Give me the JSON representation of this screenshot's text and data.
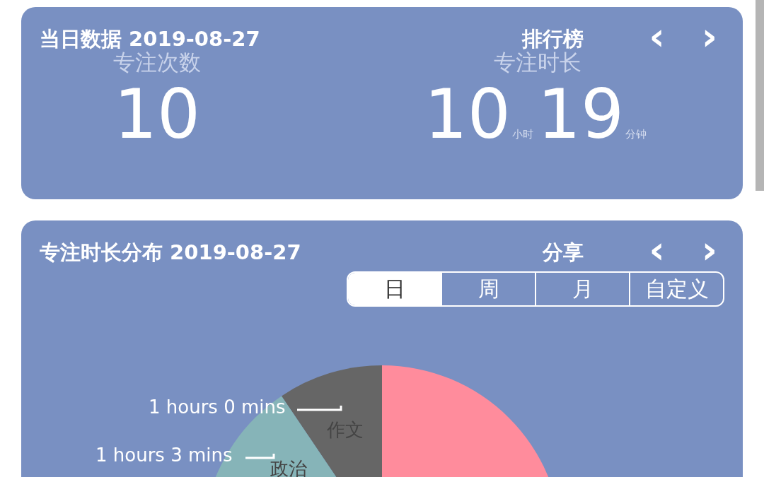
{
  "daily_card": {
    "title": "当日数据",
    "date": "2019-08-27",
    "action": "排行榜",
    "prev": "‹",
    "next": "›",
    "count": {
      "label": "专注次数",
      "value": "10"
    },
    "duration": {
      "label": "专注时长",
      "hours": "10",
      "hours_unit": "小时",
      "minutes": "19",
      "minutes_unit": "分钟"
    }
  },
  "distribution_card": {
    "title": "专注时长分布",
    "date": "2019-08-27",
    "action": "分享",
    "prev": "‹",
    "next": "›",
    "periods": [
      {
        "label": "日",
        "selected": true
      },
      {
        "label": "周",
        "selected": false
      },
      {
        "label": "月",
        "selected": false
      },
      {
        "label": "自定义",
        "selected": false
      }
    ],
    "slices": [
      {
        "color": "#ff8c9c"
      },
      {
        "name": "作文",
        "duration": "1 hours 0 mins",
        "color": "#666666"
      },
      {
        "name": "政治",
        "duration": "1 hours 3 mins",
        "color": "#86b4b8"
      }
    ]
  }
}
